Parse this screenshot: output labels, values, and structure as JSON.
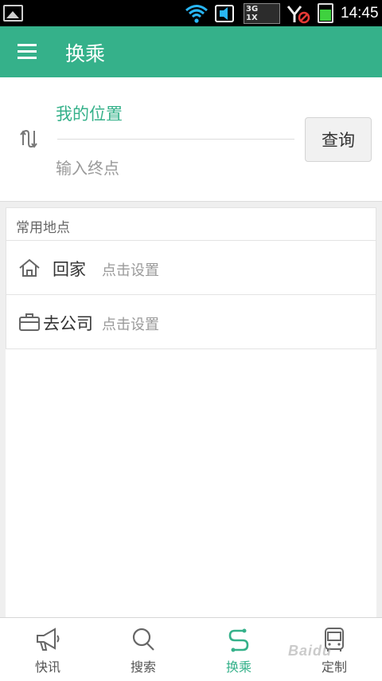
{
  "status_bar": {
    "time": "14:45",
    "network_label_top": "3G",
    "network_label_bottom": "1X",
    "icons": [
      "gallery-icon",
      "wifi-icon",
      "sim-icon",
      "signal-icon",
      "no-signal-icon",
      "battery-icon"
    ]
  },
  "app_bar": {
    "title": "换乘",
    "menu_icon": "menu-icon"
  },
  "route": {
    "from_label": "我的位置",
    "to_placeholder": "输入终点",
    "to_value": "",
    "query_button": "查询",
    "swap_icon": "swap-icon",
    "accent_color": "#35b18a"
  },
  "places": {
    "header": "常用地点",
    "items": [
      {
        "name": "回家",
        "hint": "点击设置",
        "icon": "home-icon"
      },
      {
        "name": "去公司",
        "hint": "点击设置",
        "icon": "briefcase-icon"
      }
    ]
  },
  "bottom_nav": {
    "tabs": [
      {
        "label": "快讯",
        "icon": "megaphone-icon",
        "active": false
      },
      {
        "label": "搜索",
        "icon": "search-icon",
        "active": false
      },
      {
        "label": "换乘",
        "icon": "transfer-icon",
        "active": true
      },
      {
        "label": "定制",
        "icon": "bus-icon",
        "active": false
      }
    ]
  },
  "watermark": "Baidu"
}
